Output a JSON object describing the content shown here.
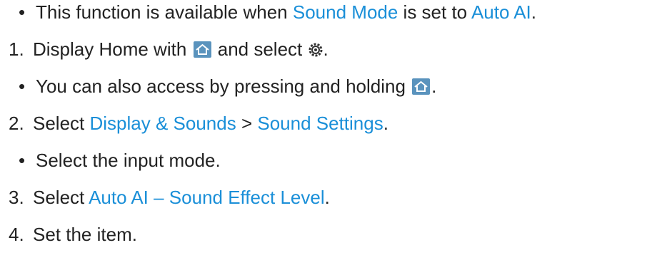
{
  "items": [
    {
      "segments": [
        "This function is available when ",
        "Sound Mode",
        " is set to ",
        "Auto AI",
        "."
      ]
    },
    {
      "number": "1.",
      "segments": [
        "Display Home with ",
        " and select ",
        "."
      ]
    },
    {
      "segments": [
        "You can also access by pressing and holding ",
        "."
      ]
    },
    {
      "number": "2.",
      "segments": [
        "Select ",
        "Display & Sounds",
        " > ",
        "Sound Settings",
        "."
      ]
    },
    {
      "segments": [
        "Select the input mode."
      ]
    },
    {
      "number": "3.",
      "segments": [
        "Select ",
        "Auto AI – Sound Effect Level",
        "."
      ]
    },
    {
      "number": "4.",
      "segments": [
        "Set the item."
      ]
    }
  ],
  "bullet": "•",
  "colors": {
    "text": "#222222",
    "link": "#1a8fd8",
    "icon_bg": "#5a93bd",
    "icon_fg": "#ffffff"
  },
  "icons": {
    "home": "home-button-icon",
    "settings": "settings-gear-icon"
  }
}
